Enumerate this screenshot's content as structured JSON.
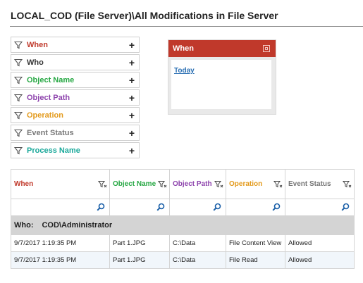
{
  "page": {
    "title": "LOCAL_COD (File Server)\\All Modifications in File Server"
  },
  "filters": [
    {
      "label": "When",
      "color": "#c0392b",
      "action_icon": "plus-icon"
    },
    {
      "label": "Who",
      "color": "#333333",
      "action_icon": "plus-icon"
    },
    {
      "label": "Object Name",
      "color": "#27a844",
      "action_icon": "plus-icon"
    },
    {
      "label": "Object Path",
      "color": "#8e44ad",
      "action_icon": "plus-icon"
    },
    {
      "label": "Operation",
      "color": "#e39a1c",
      "action_icon": "plus-icon"
    },
    {
      "label": "Event Status",
      "color": "#777777",
      "action_icon": "plus-icon"
    },
    {
      "label": "Process Name",
      "color": "#1aa89a",
      "action_icon": "plus-icon"
    }
  ],
  "when_panel": {
    "title": "When",
    "link": "Today",
    "header_color": "#c0392b"
  },
  "grid": {
    "columns": [
      {
        "label": "When",
        "color": "#c0392b"
      },
      {
        "label": "Object Name",
        "color": "#27a844"
      },
      {
        "label": "Object Path",
        "color": "#8e44ad"
      },
      {
        "label": "Operation",
        "color": "#e39a1c"
      },
      {
        "label": "Event Status",
        "color": "#777777"
      }
    ],
    "group": {
      "label": "Who:",
      "value": "COD\\Administrator"
    },
    "rows": [
      [
        "9/7/2017 1:19:35 PM",
        "Part 1.JPG",
        "C:\\Data",
        "File Content View",
        "Allowed"
      ],
      [
        "9/7/2017 1:19:35 PM",
        "Part 1.JPG",
        "C:\\Data",
        "File Read",
        "Allowed"
      ]
    ]
  }
}
